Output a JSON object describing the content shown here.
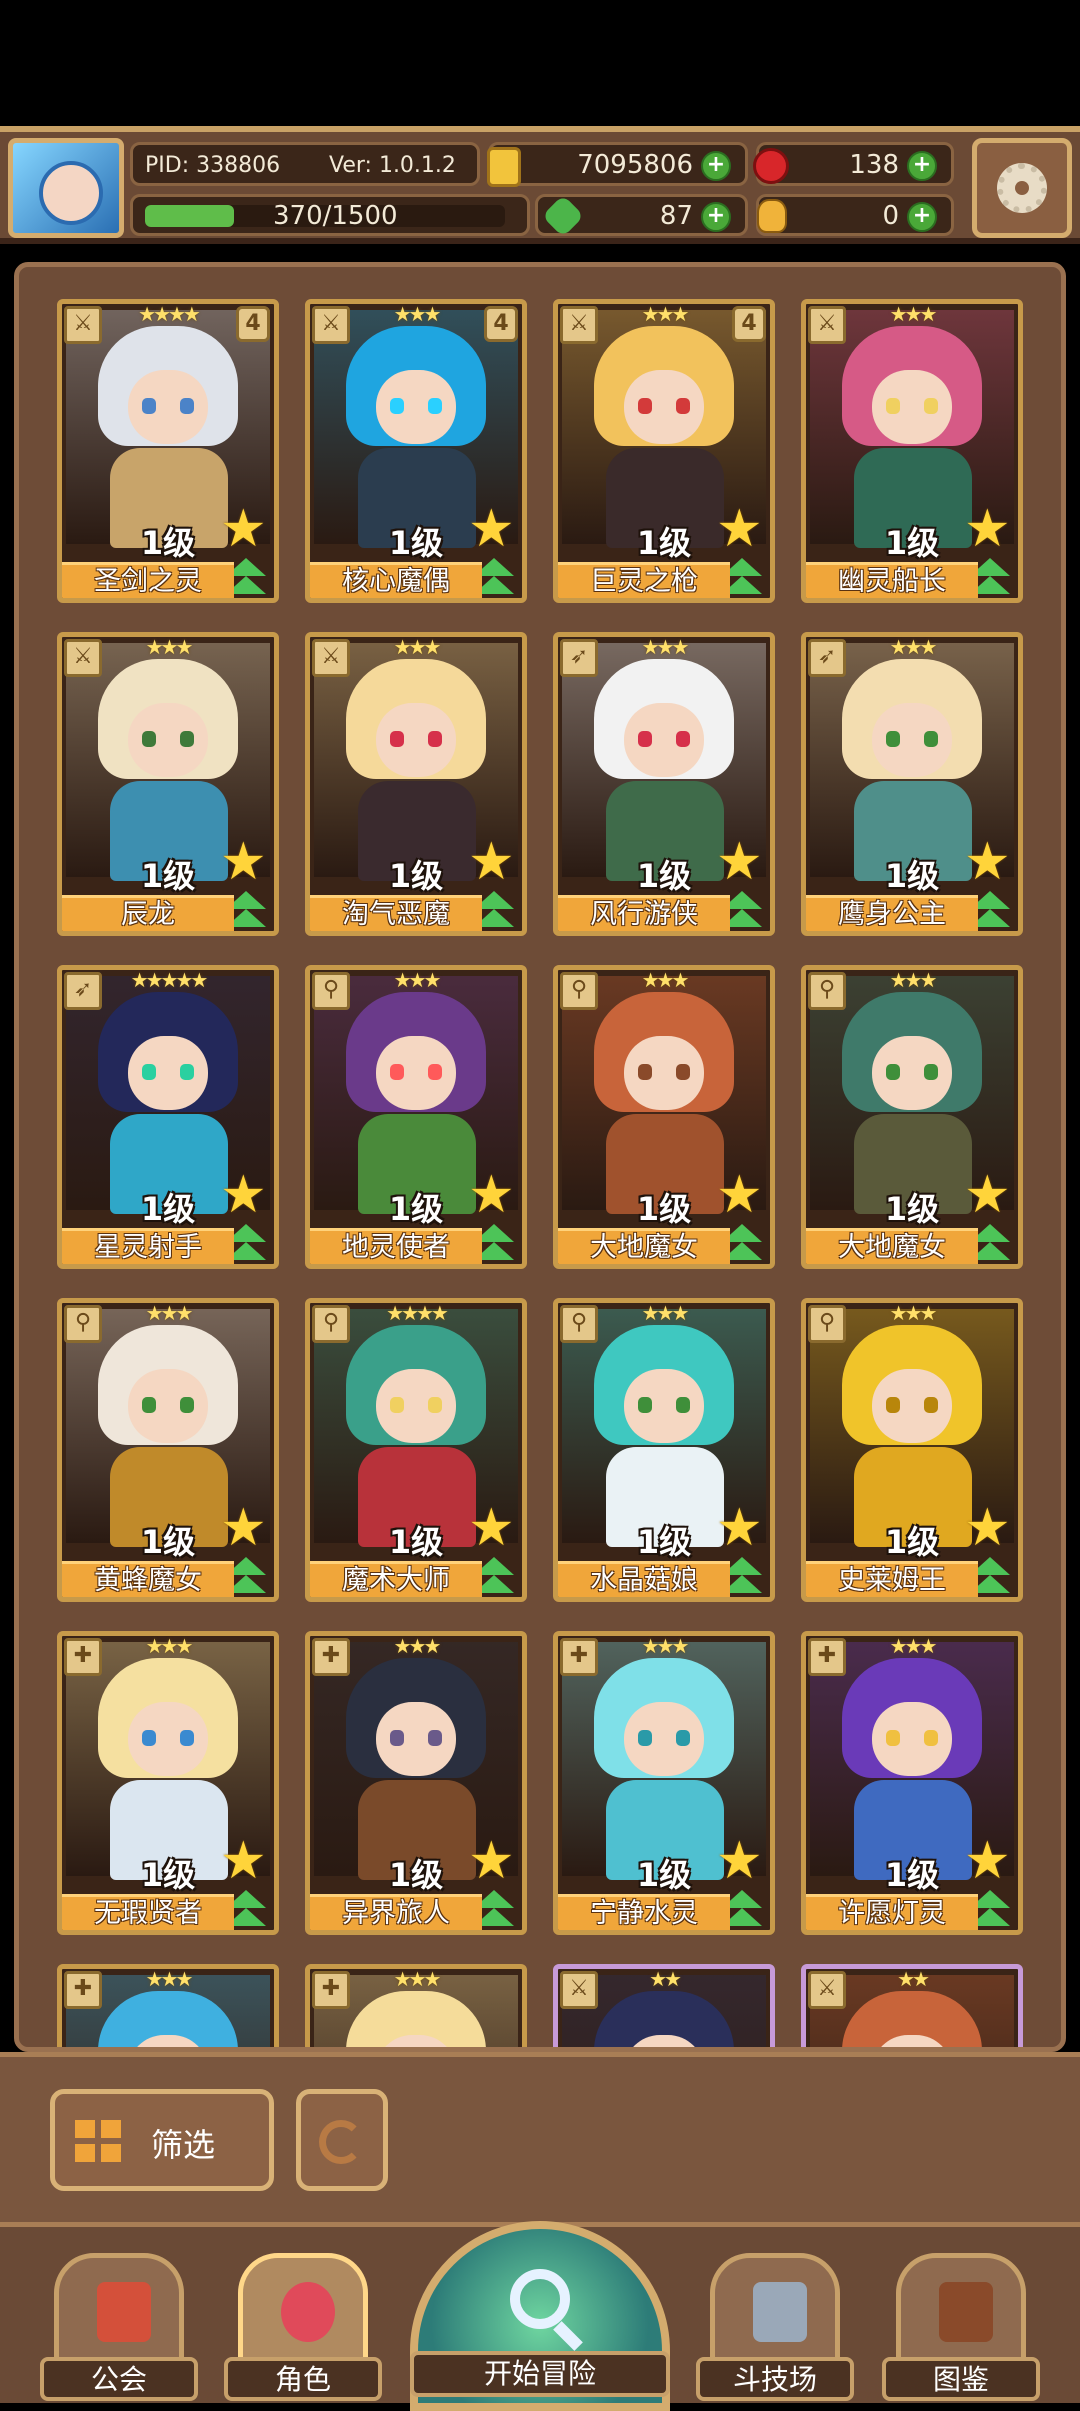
{
  "header": {
    "pid": "PID: 338806",
    "version": "Ver: 1.0.1.2",
    "gold": "7095806",
    "ruby": "138",
    "exp": "370/1500",
    "exp_progress": 0.2467,
    "clover": "87",
    "potion": "0"
  },
  "colors": {
    "card_border_gold": "#c79a4a",
    "card_border_purple": "#c79ad8",
    "name_plate": "#f0a63a",
    "upgrade_green": "#4dc458"
  },
  "roster": [
    {
      "name": "圣剑之灵",
      "level": "1级",
      "stars": "★★★★",
      "badge": "4",
      "class_icon": "sword-icon",
      "hair": "#dfe3ea",
      "body": "#c8a46a",
      "eye": "#4b83c8"
    },
    {
      "name": "核心魔偶",
      "level": "1级",
      "stars": "★★★",
      "badge": "4",
      "class_icon": "sword-icon",
      "hair": "#1fa5e0",
      "body": "#2b3d4f",
      "eye": "#2ad0ff"
    },
    {
      "name": "巨灵之枪",
      "level": "1级",
      "stars": "★★★",
      "badge": "4",
      "class_icon": "sword-icon",
      "hair": "#f2c25c",
      "body": "#3a2a2a",
      "eye": "#d33a3a"
    },
    {
      "name": "幽灵船长",
      "level": "1级",
      "stars": "★★★",
      "badge": "",
      "class_icon": "sword-icon",
      "hair": "#d65a86",
      "body": "#2f6a55",
      "eye": "#f0d060"
    },
    {
      "name": "辰龙",
      "level": "1级",
      "stars": "★★★",
      "badge": "",
      "class_icon": "sword-icon",
      "hair": "#f0e2c2",
      "body": "#3d8fb0",
      "eye": "#3f7a3a"
    },
    {
      "name": "淘气恶魔",
      "level": "1级",
      "stars": "★★★",
      "badge": "",
      "class_icon": "sword-icon",
      "hair": "#f5d99a",
      "body": "#3a2a2e",
      "eye": "#d6304a"
    },
    {
      "name": "风行游侠",
      "level": "1级",
      "stars": "★★★",
      "badge": "",
      "class_icon": "bow-icon",
      "hair": "#f2f2f2",
      "body": "#3f6b4a",
      "eye": "#d6304a"
    },
    {
      "name": "鹰身公主",
      "level": "1级",
      "stars": "★★★",
      "badge": "",
      "class_icon": "bow-icon",
      "hair": "#f3ddb0",
      "body": "#4f8f8a",
      "eye": "#3f8f3a"
    },
    {
      "name": "星灵射手",
      "level": "1级",
      "stars": "★★★★★",
      "badge": "",
      "class_icon": "bow-icon",
      "hair": "#23285a",
      "body": "#2fa7c8",
      "eye": "#2ad0a0"
    },
    {
      "name": "地灵使者",
      "level": "1级",
      "stars": "★★★",
      "badge": "",
      "class_icon": "staff-icon",
      "hair": "#6a3a8a",
      "body": "#4a8a3a",
      "eye": "#ff5a5a"
    },
    {
      "name": "大地魔女",
      "level": "1级",
      "stars": "★★★",
      "badge": "",
      "class_icon": "staff-icon",
      "hair": "#c8643a",
      "body": "#a0522d",
      "eye": "#8a4a2a"
    },
    {
      "name": "大地魔女",
      "level": "1级",
      "stars": "★★★",
      "badge": "",
      "class_icon": "staff-icon",
      "hair": "#3f7a6a",
      "body": "#5a5a3a",
      "eye": "#3f8f3a"
    },
    {
      "name": "黄蜂魔女",
      "level": "1级",
      "stars": "★★★",
      "badge": "",
      "class_icon": "staff-icon",
      "hair": "#efe6da",
      "body": "#c08a2a",
      "eye": "#3f8f3a"
    },
    {
      "name": "魔术大师",
      "level": "1级",
      "stars": "★★★★",
      "badge": "",
      "class_icon": "staff-icon",
      "hair": "#3aa08a",
      "body": "#b8323a",
      "eye": "#f0d060"
    },
    {
      "name": "水晶菇娘",
      "level": "1级",
      "stars": "★★★",
      "badge": "",
      "class_icon": "staff-icon",
      "hair": "#3fc8c0",
      "body": "#eaf2f5",
      "eye": "#3f8f3a"
    },
    {
      "name": "史莱姆王",
      "level": "1级",
      "stars": "★★★",
      "badge": "",
      "class_icon": "staff-icon",
      "hair": "#f0c42a",
      "body": "#e0a820",
      "eye": "#b8860b"
    },
    {
      "name": "无瑕贤者",
      "level": "1级",
      "stars": "★★★",
      "badge": "",
      "class_icon": "cross-icon",
      "hair": "#f5e0a0",
      "body": "#dbe6f0",
      "eye": "#3a8ad0"
    },
    {
      "name": "异界旅人",
      "level": "1级",
      "stars": "★★★",
      "badge": "",
      "class_icon": "cross-icon",
      "hair": "#2a2f3f",
      "body": "#7a4a2a",
      "eye": "#6a5a8a"
    },
    {
      "name": "宁静水灵",
      "level": "1级",
      "stars": "★★★",
      "badge": "",
      "class_icon": "cross-icon",
      "hair": "#7fe0e8",
      "body": "#4fc0d0",
      "eye": "#2a9aa8"
    },
    {
      "name": "许愿灯灵",
      "level": "1级",
      "stars": "★★★",
      "badge": "",
      "class_icon": "cross-icon",
      "hair": "#6a3ab8",
      "body": "#3f6ac0",
      "eye": "#f0c040"
    },
    {
      "name": "",
      "level": "",
      "stars": "★★★",
      "badge": "",
      "class_icon": "cross-icon",
      "hair": "#3fb0e0",
      "body": "#3fb0e0",
      "eye": "#3fb0e0",
      "purple": false
    },
    {
      "name": "",
      "level": "",
      "stars": "★★★",
      "badge": "",
      "class_icon": "cross-icon",
      "hair": "#f5dc9a",
      "body": "#f5dc9a",
      "eye": "#f5dc9a",
      "purple": false
    },
    {
      "name": "",
      "level": "",
      "stars": "★★",
      "badge": "",
      "class_icon": "sword-icon",
      "hair": "#2a2f5a",
      "body": "#2a2f5a",
      "eye": "#2a2f5a",
      "purple": true
    },
    {
      "name": "",
      "level": "",
      "stars": "★★",
      "badge": "",
      "class_icon": "sword-icon",
      "hair": "#c8643a",
      "body": "#c8643a",
      "eye": "#c8643a",
      "purple": true
    }
  ],
  "toolbar": {
    "filter_label": "筛选"
  },
  "nav": {
    "guild": "公会",
    "characters": "角色",
    "adventure": "开始冒险",
    "arena": "斗技场",
    "codex": "图鉴"
  }
}
